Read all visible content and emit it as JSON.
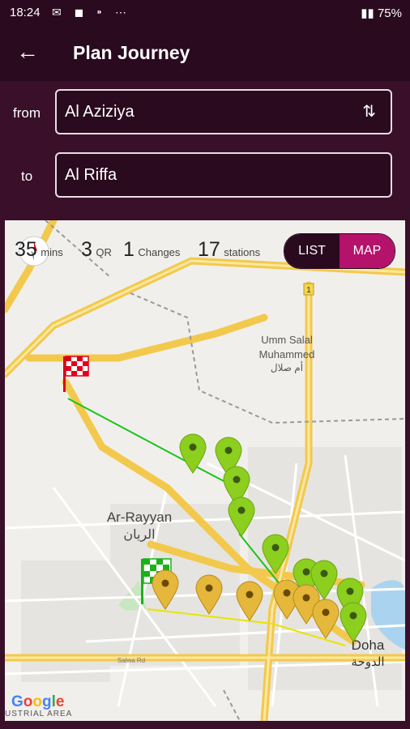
{
  "status": {
    "time": "18:24",
    "icons": "✉ ◼ ⁍ ⋯",
    "battery": "75%"
  },
  "header": {
    "back_icon": "arrow-left-icon",
    "title": "Plan Journey"
  },
  "form": {
    "from_label": "from",
    "from_value": "Al Aziziya",
    "to_label": "to",
    "to_value": "Al Riffa",
    "swap_icon": "swap-vertical-icon"
  },
  "summary": {
    "mins_value": "35",
    "mins_unit": "mins",
    "qr_value": "3",
    "qr_unit": "QR",
    "changes_value": "1",
    "changes_unit": "Changes",
    "stations_value": "17",
    "stations_unit": "stations"
  },
  "view_toggle": {
    "list_label": "LIST",
    "map_label": "MAP",
    "selected": "MAP"
  },
  "map": {
    "labels": {
      "umm_salal_1": "Umm Salal",
      "umm_salal_2": "Muhammed",
      "umm_salal_ar": "أم صلال",
      "rayyan": "Ar-Rayyan",
      "rayyan_ar": "الريان",
      "doha": "Doha",
      "doha_ar": "الدوحة",
      "road_1": "1",
      "salwa_rd": "Salwa Rd",
      "industrial": "USTRIAL AREA"
    },
    "attribution": "Google",
    "colors": {
      "green_line": "#19c519",
      "yellow_line": "#e8e400",
      "green_pin": "#8ccf1f",
      "yellow_pin": "#e5b73b"
    }
  }
}
